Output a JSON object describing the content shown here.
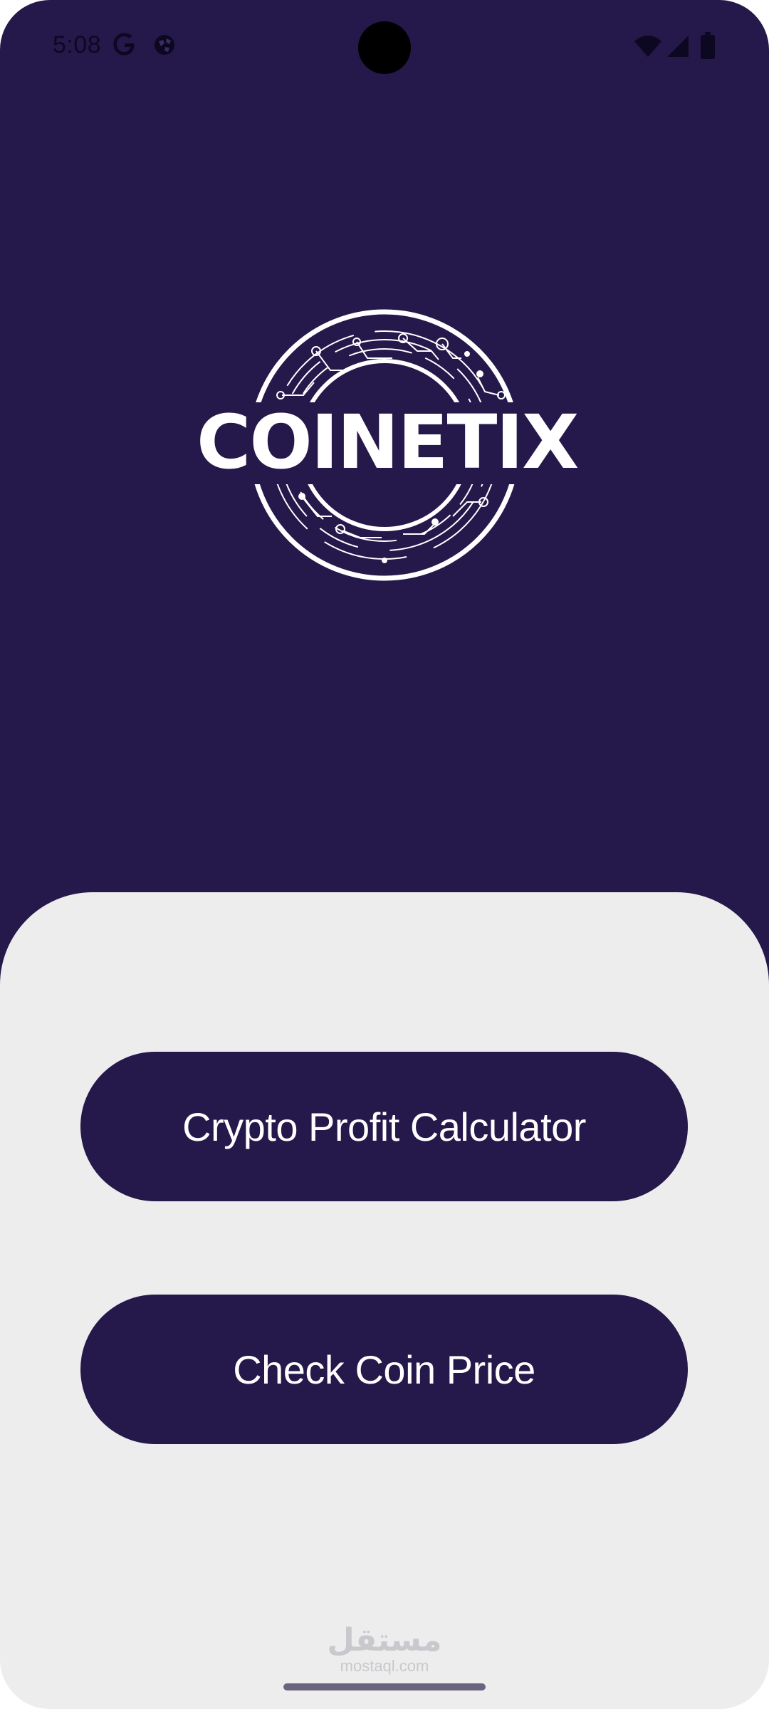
{
  "status_bar": {
    "time": "5:08",
    "left_icons": [
      "google-g-icon",
      "globe-icon"
    ],
    "right_icons": [
      "wifi-icon",
      "cellular-signal-icon",
      "battery-icon"
    ]
  },
  "logo": {
    "text": "COINETIX",
    "icon": "circuit-ring-icon"
  },
  "actions": {
    "profit_calculator_label": "Crypto Profit Calculator",
    "check_price_label": "Check Coin Price"
  },
  "watermark": {
    "arabic": "مستقل",
    "latin": "mostaql.com"
  },
  "colors": {
    "primary": "#25184a",
    "background": "#ededee",
    "on_primary": "#ffffff"
  }
}
